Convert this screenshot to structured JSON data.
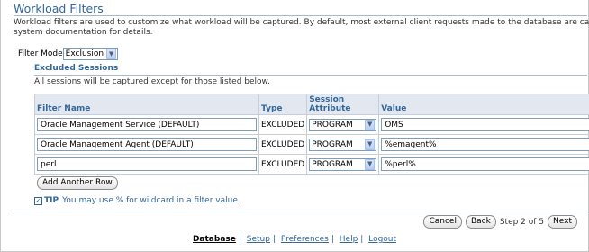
{
  "header": {
    "title": "Workload Filters",
    "description_line1": "Workload filters are used to customize what workload will be captured. By default, most external client requests made to the database are captu",
    "description_line2": "system documentation for details."
  },
  "filter_mode": {
    "label": "Filter Mode",
    "value": "Exclusion"
  },
  "excluded_sessions": {
    "title": "Excluded Sessions",
    "description": "All sessions will be captured except for those listed below.",
    "columns": {
      "filter_name": "Filter Name",
      "type": "Type",
      "session_attribute": "Session Attribute",
      "value": "Value"
    },
    "rows": [
      {
        "filter_name": "Oracle Management Service (DEFAULT)",
        "type": "EXCLUDED",
        "attribute": "PROGRAM",
        "value": "OMS"
      },
      {
        "filter_name": "Oracle Management Agent (DEFAULT)",
        "type": "EXCLUDED",
        "attribute": "PROGRAM",
        "value": "%emagent%"
      },
      {
        "filter_name": "perl",
        "type": "EXCLUDED",
        "attribute": "PROGRAM",
        "value": "%perl%"
      }
    ],
    "add_row_label": "Add Another Row"
  },
  "tip": {
    "label": "TIP",
    "text": "You may use % for wildcard in a filter value."
  },
  "wizard": {
    "cancel_label": "Cancel",
    "back_label": "Back",
    "step_text": "Step 2 of 5",
    "next_label": "Next"
  },
  "footer": {
    "links": [
      "Database",
      "Setup",
      "Preferences",
      "Help",
      "Logout"
    ]
  },
  "colors": {
    "accent": "#336699",
    "header_bg": "#e3e8f0"
  }
}
